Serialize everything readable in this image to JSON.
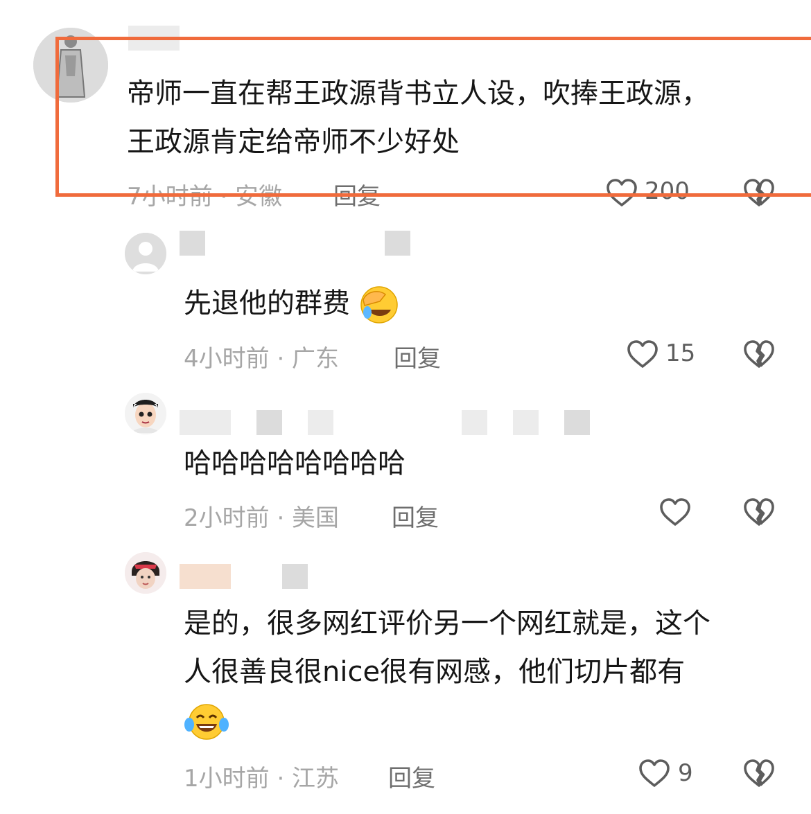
{
  "comments": [
    {
      "text_line1": "帝师一直在帮王政源背书立人设，吹捧王政源，",
      "text_line2": "王政源肯定给帝师不少好处",
      "meta": "7小时前 · 安徽",
      "reply_label": "回复",
      "likes": "200"
    },
    {
      "text": "先退他的群费",
      "meta": "4小时前 · 广东",
      "reply_label": "回复",
      "likes": "15"
    },
    {
      "text": "哈哈哈哈哈哈哈哈",
      "meta": "2小时前 · 美国",
      "reply_label": "回复",
      "likes": ""
    },
    {
      "text_line1": "是的，很多网红评价另一个网红就是，这个",
      "text_line2": "人很善良很nice很有网感，他们切片都有",
      "meta": "1小时前 · 江苏",
      "reply_label": "回复",
      "likes": "9"
    }
  ],
  "colors": {
    "highlight_border": "#f06b3c",
    "meta_text": "#a6a6a6",
    "icon_stroke": "#5d5d5d"
  },
  "icons": {
    "like": "heart-icon",
    "dislike": "broken-heart-icon",
    "emoji_facepalm": "facepalm-laugh-emoji",
    "emoji_tears": "tears-of-joy-emoji"
  }
}
